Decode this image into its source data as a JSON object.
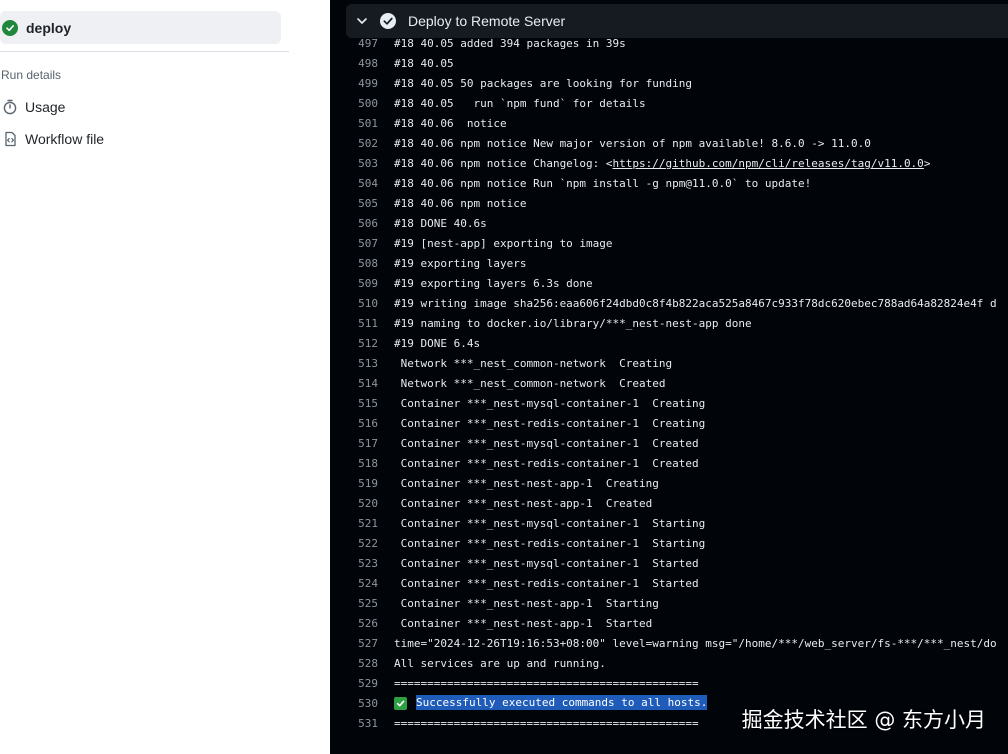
{
  "sidebar": {
    "job_label": "deploy",
    "section_label": "Run details",
    "nav": [
      {
        "label": "Usage",
        "icon": "stopwatch-icon"
      },
      {
        "label": "Workflow file",
        "icon": "file-code-icon"
      }
    ]
  },
  "step": {
    "title": "Deploy to Remote Server",
    "status": "success"
  },
  "log": [
    {
      "no": "497",
      "text": "#18 40.05 added 394 packages in 39s"
    },
    {
      "no": "498",
      "text": "#18 40.05"
    },
    {
      "no": "499",
      "text": "#18 40.05 50 packages are looking for funding"
    },
    {
      "no": "500",
      "text": "#18 40.05   run `npm fund` for details"
    },
    {
      "no": "501",
      "text": "#18 40.06  notice"
    },
    {
      "no": "502",
      "text": "#18 40.06 npm notice New major version of npm available! 8.6.0 -> 11.0.0"
    },
    {
      "no": "503",
      "text_before": "#18 40.06 npm notice Changelog: <",
      "link": "https://github.com/npm/cli/releases/tag/v11.0.0",
      "text_after": ">"
    },
    {
      "no": "504",
      "text": "#18 40.06 npm notice Run `npm install -g npm@11.0.0` to update!"
    },
    {
      "no": "505",
      "text": "#18 40.06 npm notice"
    },
    {
      "no": "506",
      "text": "#18 DONE 40.6s"
    },
    {
      "no": "507",
      "text": "#19 [nest-app] exporting to image"
    },
    {
      "no": "508",
      "text": "#19 exporting layers"
    },
    {
      "no": "509",
      "text": "#19 exporting layers 6.3s done"
    },
    {
      "no": "510",
      "text": "#19 writing image sha256:eaa606f24dbd0c8f4b822aca525a8467c933f78dc620ebec788ad64a82824e4f d"
    },
    {
      "no": "511",
      "text": "#19 naming to docker.io/library/***_nest-nest-app done"
    },
    {
      "no": "512",
      "text": "#19 DONE 6.4s"
    },
    {
      "no": "513",
      "text": " Network ***_nest_common-network  Creating"
    },
    {
      "no": "514",
      "text": " Network ***_nest_common-network  Created"
    },
    {
      "no": "515",
      "text": " Container ***_nest-mysql-container-1  Creating"
    },
    {
      "no": "516",
      "text": " Container ***_nest-redis-container-1  Creating"
    },
    {
      "no": "517",
      "text": " Container ***_nest-mysql-container-1  Created"
    },
    {
      "no": "518",
      "text": " Container ***_nest-redis-container-1  Created"
    },
    {
      "no": "519",
      "text": " Container ***_nest-nest-app-1  Creating"
    },
    {
      "no": "520",
      "text": " Container ***_nest-nest-app-1  Created"
    },
    {
      "no": "521",
      "text": " Container ***_nest-mysql-container-1  Starting"
    },
    {
      "no": "522",
      "text": " Container ***_nest-redis-container-1  Starting"
    },
    {
      "no": "523",
      "text": " Container ***_nest-mysql-container-1  Started"
    },
    {
      "no": "524",
      "text": " Container ***_nest-redis-container-1  Started"
    },
    {
      "no": "525",
      "text": " Container ***_nest-nest-app-1  Starting"
    },
    {
      "no": "526",
      "text": " Container ***_nest-nest-app-1  Started"
    },
    {
      "no": "527",
      "text": "time=\"2024-12-26T19:16:53+08:00\" level=warning msg=\"/home/***/web_server/fs-***/***_nest/do"
    },
    {
      "no": "528",
      "text": "All services are up and running."
    },
    {
      "no": "529",
      "text": "=============================================="
    },
    {
      "no": "530",
      "text": "Successfully executed commands to all hosts.",
      "highlighted": true
    },
    {
      "no": "531",
      "text": "=============================================="
    }
  ],
  "watermark": "掘金技术社区 @ 东方小月",
  "colors": {
    "success": "#1f883d",
    "log_bg": "#010409",
    "highlight": "#1f5bb8",
    "annotation_arrow": "#e8321e"
  }
}
